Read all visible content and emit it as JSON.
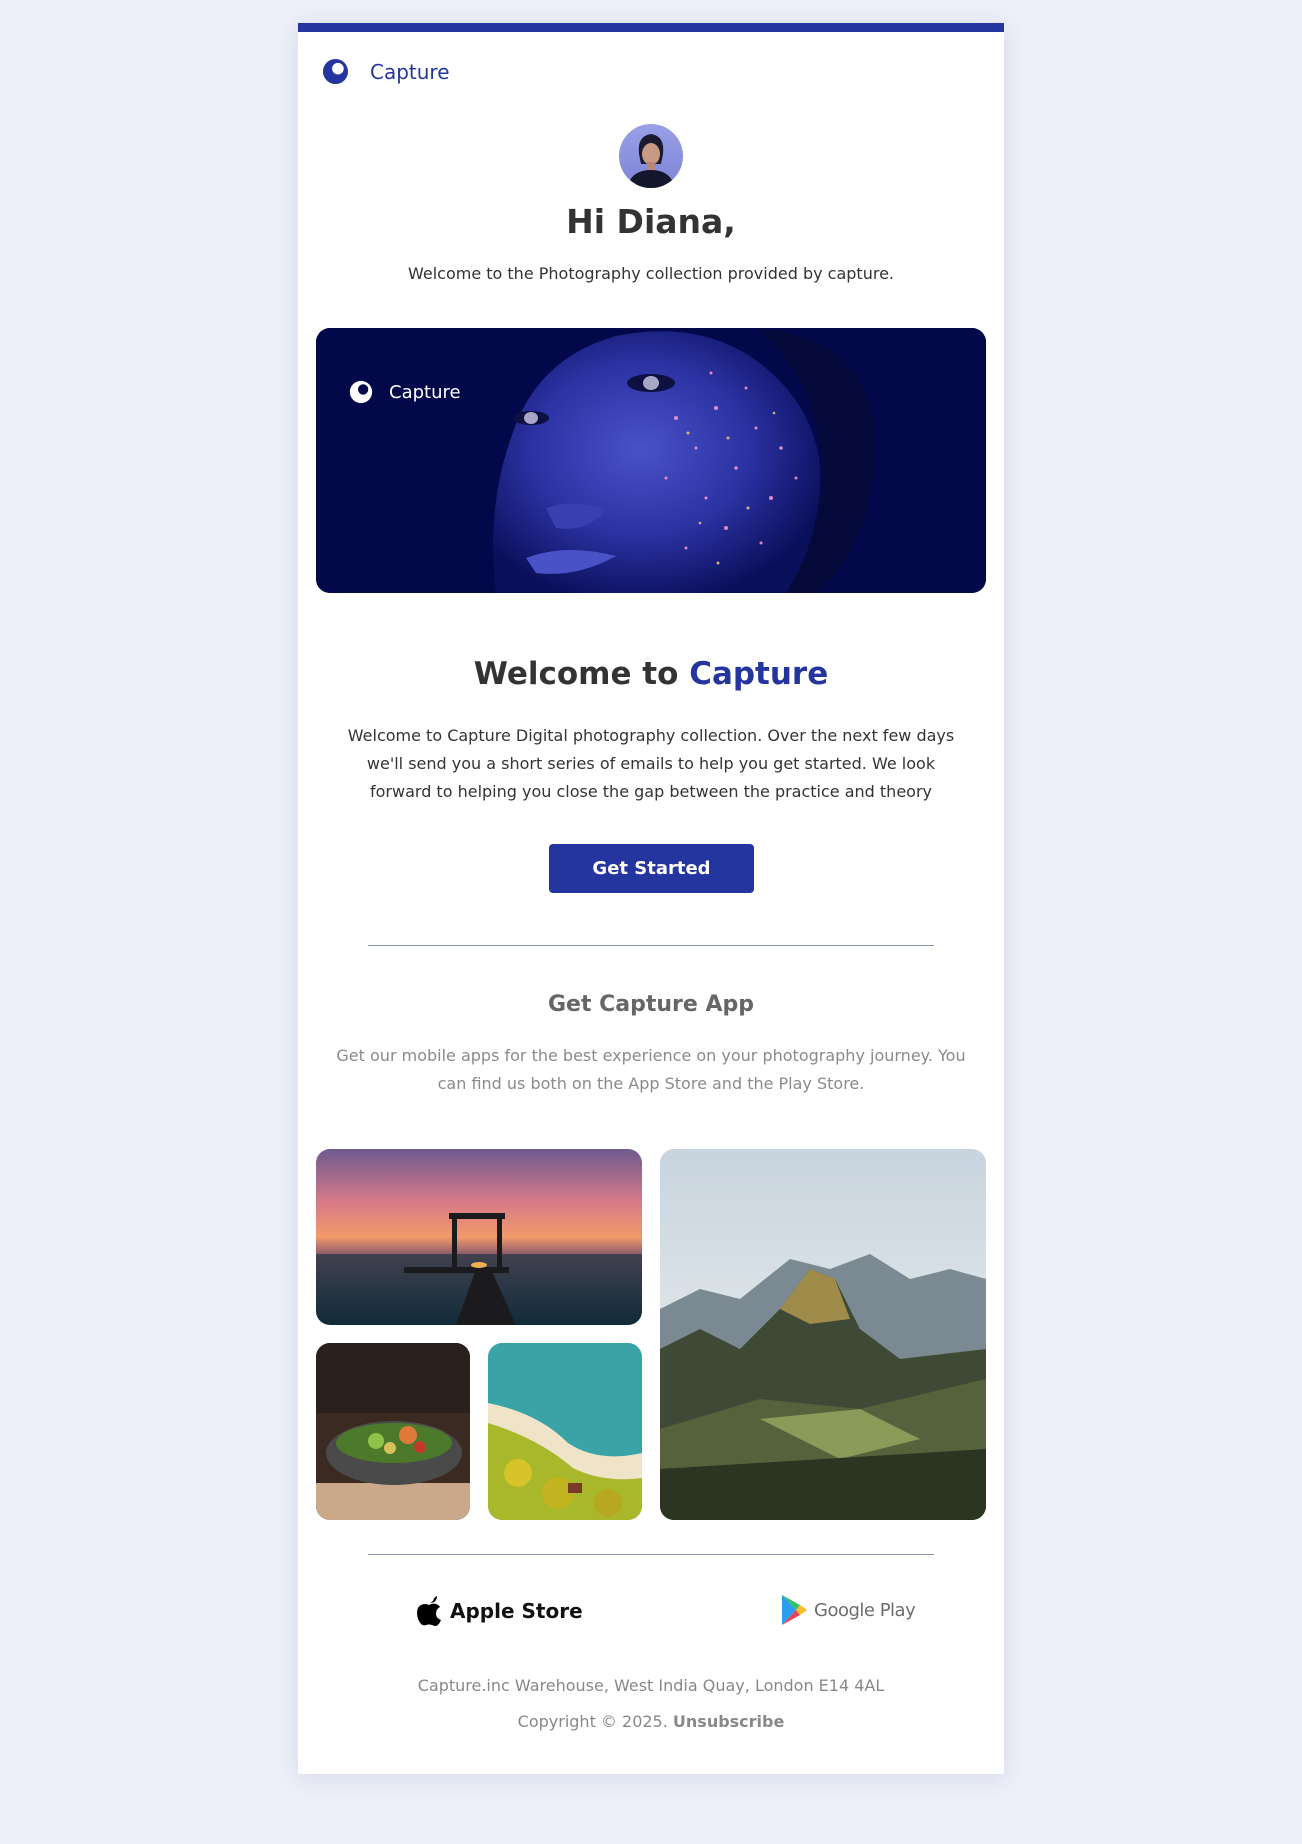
{
  "brand": {
    "name": "Capture",
    "accent": "#2435a0"
  },
  "greeting": {
    "title": "Hi Diana,",
    "subtitle": "Welcome to the Photography collection provided by capture."
  },
  "hero": {
    "brand_name": "Capture"
  },
  "welcome": {
    "prefix": "Welcome to ",
    "accent": "Capture",
    "body": "Welcome to Capture Digital photography collection. Over the next few days we'll send you a short series of emails to help you get started. We look forward to helping you close the gap between the practice and theory",
    "cta_label": "Get Started"
  },
  "app": {
    "title": "Get Capture App",
    "text": "Get our mobile apps for the best experience on your photography journey. You can find us both on the App Store and the Play Store."
  },
  "stores": {
    "apple_label": "Apple Store",
    "google_label": "Google Play"
  },
  "footer": {
    "address": "Capture.inc Warehouse, West India Quay, London E14 4AL",
    "copyright": "Copyright © 2025.",
    "unsubscribe": "Unsubscribe"
  },
  "icons": [
    "brand-logo-icon",
    "apple-icon",
    "google-play-icon"
  ]
}
